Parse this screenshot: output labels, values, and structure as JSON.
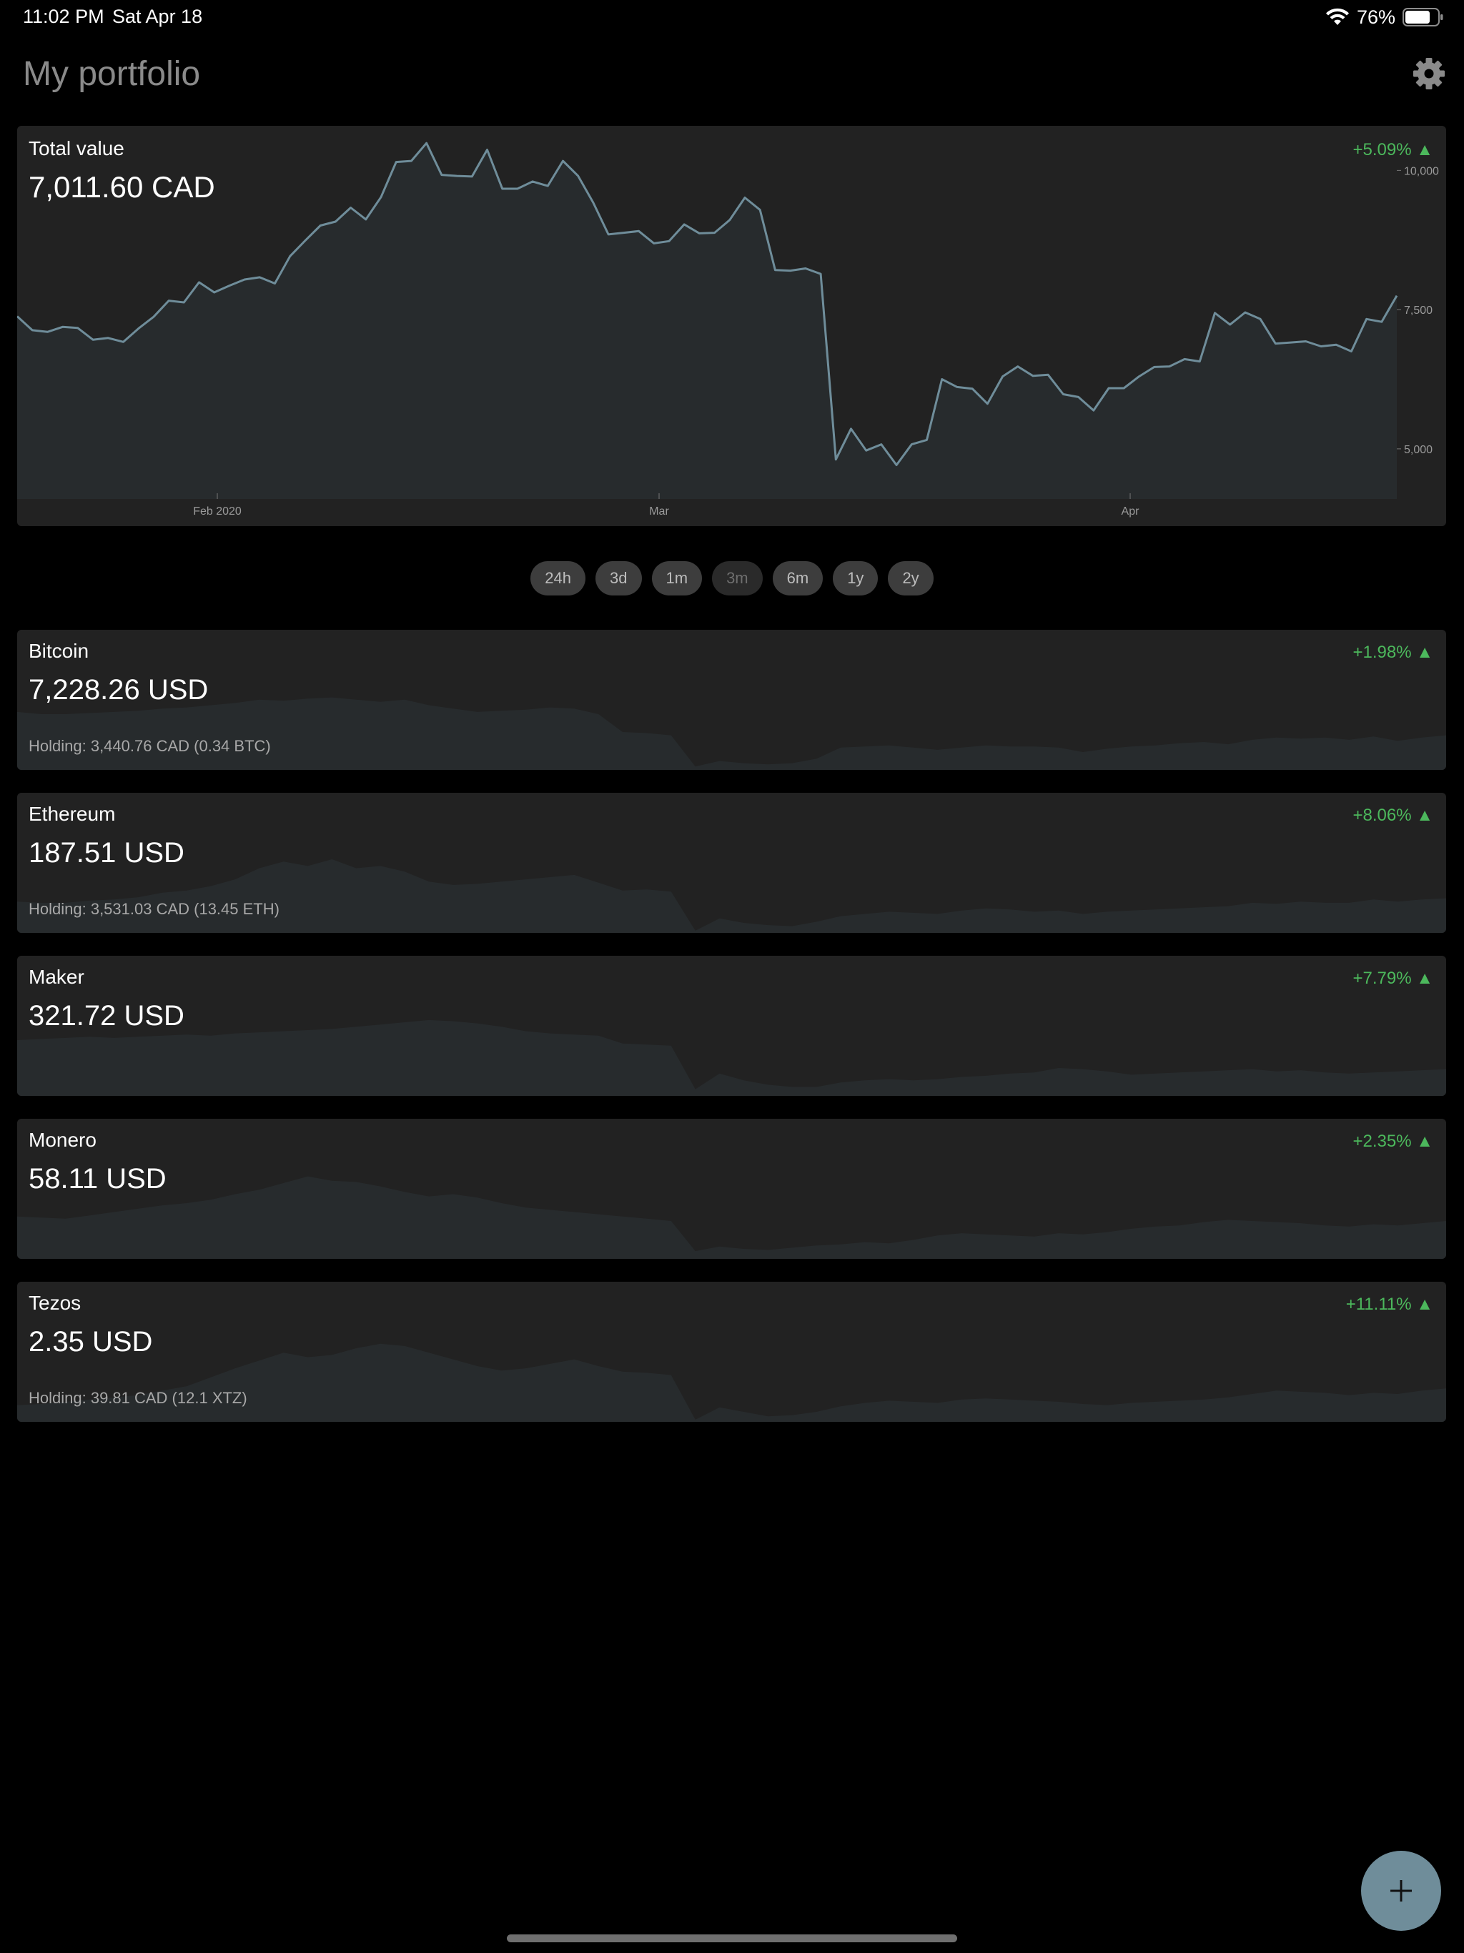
{
  "status_bar": {
    "time": "11:02 PM",
    "date": "Sat Apr 18",
    "battery": "76%"
  },
  "header": {
    "title": "My portfolio"
  },
  "total": {
    "label": "Total value",
    "value": "7,011.60 CAD",
    "change": "+5.09% ▲"
  },
  "chart_data": {
    "type": "area",
    "title": "",
    "xlabel": "",
    "ylabel": "",
    "y_ticks": [
      "10,000",
      "7,500",
      "5,000"
    ],
    "x_ticks": [
      "Feb 2020",
      "Mar",
      "Apr"
    ],
    "ylim": [
      4100,
      10800
    ],
    "grid": false,
    "series": [
      {
        "values": [
          7380,
          7130,
          7100,
          7190,
          7170,
          6960,
          6990,
          6920,
          7160,
          7370,
          7660,
          7630,
          7990,
          7810,
          7930,
          8040,
          8080,
          7970,
          8460,
          8740,
          9010,
          9080,
          9330,
          9120,
          9520,
          10150,
          10170,
          10490,
          9920,
          9900,
          9890,
          10370,
          9670,
          9670,
          9800,
          9720,
          10170,
          9900,
          9420,
          8850,
          8880,
          8910,
          8690,
          8730,
          9030,
          8870,
          8880,
          9110,
          9510,
          9290,
          8210,
          8200,
          8240,
          8140,
          4810,
          5360,
          4970,
          5080,
          4710,
          5080,
          5160,
          6250,
          6110,
          6080,
          5810,
          6300,
          6480,
          6310,
          6330,
          5980,
          5930,
          5690,
          6090,
          6090,
          6300,
          6470,
          6480,
          6610,
          6570,
          7440,
          7230,
          7450,
          7330,
          6890,
          6910,
          6930,
          6840,
          6870,
          6750,
          7330,
          7280,
          7750
        ]
      }
    ]
  },
  "ranges": [
    {
      "label": "24h"
    },
    {
      "label": "3d"
    },
    {
      "label": "1m"
    },
    {
      "label": "3m"
    },
    {
      "label": "6m"
    },
    {
      "label": "1y"
    },
    {
      "label": "2y"
    }
  ],
  "selected_range": "3m",
  "coins": [
    {
      "name": "Bitcoin",
      "price": "7,228.26 USD",
      "change": "+1.98% ▲",
      "holding": "Holding: 3,440.76 CAD (0.34 BTC)",
      "spark": [
        0.52,
        0.5,
        0.5,
        0.51,
        0.52,
        0.53,
        0.55,
        0.56,
        0.58,
        0.6,
        0.63,
        0.62,
        0.64,
        0.65,
        0.63,
        0.61,
        0.63,
        0.58,
        0.55,
        0.52,
        0.53,
        0.54,
        0.56,
        0.55,
        0.5,
        0.34,
        0.33,
        0.31,
        0.03,
        0.08,
        0.06,
        0.05,
        0.06,
        0.1,
        0.2,
        0.21,
        0.22,
        0.2,
        0.18,
        0.2,
        0.22,
        0.21,
        0.21,
        0.2,
        0.16,
        0.19,
        0.21,
        0.22,
        0.24,
        0.25,
        0.23,
        0.27,
        0.29,
        0.28,
        0.29,
        0.27,
        0.3,
        0.26,
        0.29,
        0.31
      ]
    },
    {
      "name": "Ethereum",
      "price": "187.51 USD",
      "change": "+8.06% ▲",
      "holding": "Holding: 3,531.03 CAD (13.45 ETH)",
      "spark": [
        0.28,
        0.27,
        0.27,
        0.29,
        0.3,
        0.32,
        0.36,
        0.38,
        0.42,
        0.48,
        0.58,
        0.64,
        0.6,
        0.66,
        0.58,
        0.6,
        0.55,
        0.46,
        0.43,
        0.44,
        0.46,
        0.48,
        0.5,
        0.52,
        0.45,
        0.38,
        0.39,
        0.37,
        0.02,
        0.13,
        0.09,
        0.07,
        0.06,
        0.1,
        0.15,
        0.17,
        0.19,
        0.18,
        0.17,
        0.2,
        0.22,
        0.21,
        0.19,
        0.2,
        0.17,
        0.19,
        0.2,
        0.21,
        0.22,
        0.23,
        0.24,
        0.27,
        0.26,
        0.28,
        0.27,
        0.27,
        0.3,
        0.28,
        0.3,
        0.31
      ]
    },
    {
      "name": "Maker",
      "price": "321.72 USD",
      "change": "+7.79% ▲",
      "holding": "",
      "spark": [
        0.5,
        0.51,
        0.52,
        0.53,
        0.52,
        0.53,
        0.54,
        0.55,
        0.54,
        0.56,
        0.57,
        0.58,
        0.59,
        0.6,
        0.62,
        0.64,
        0.66,
        0.68,
        0.67,
        0.65,
        0.62,
        0.58,
        0.56,
        0.55,
        0.54,
        0.47,
        0.46,
        0.45,
        0.06,
        0.2,
        0.14,
        0.1,
        0.08,
        0.08,
        0.12,
        0.14,
        0.15,
        0.14,
        0.15,
        0.17,
        0.18,
        0.2,
        0.21,
        0.25,
        0.24,
        0.22,
        0.19,
        0.2,
        0.21,
        0.22,
        0.23,
        0.24,
        0.22,
        0.23,
        0.21,
        0.2,
        0.21,
        0.22,
        0.23,
        0.24
      ]
    },
    {
      "name": "Monero",
      "price": "58.11 USD",
      "change": "+2.35% ▲",
      "holding": "",
      "spark": [
        0.38,
        0.37,
        0.36,
        0.39,
        0.42,
        0.45,
        0.48,
        0.5,
        0.53,
        0.58,
        0.62,
        0.68,
        0.74,
        0.7,
        0.69,
        0.65,
        0.6,
        0.56,
        0.58,
        0.55,
        0.5,
        0.46,
        0.44,
        0.42,
        0.4,
        0.38,
        0.36,
        0.34,
        0.07,
        0.11,
        0.09,
        0.08,
        0.1,
        0.12,
        0.13,
        0.15,
        0.14,
        0.17,
        0.21,
        0.23,
        0.22,
        0.21,
        0.2,
        0.23,
        0.22,
        0.24,
        0.27,
        0.29,
        0.3,
        0.33,
        0.35,
        0.34,
        0.33,
        0.32,
        0.3,
        0.29,
        0.31,
        0.3,
        0.32,
        0.34
      ]
    },
    {
      "name": "Tezos",
      "price": "2.35 USD",
      "change": "+11.11% ▲",
      "holding": "Holding: 39.81 CAD (12.1 XTZ)",
      "spark": [
        0.15,
        0.16,
        0.18,
        0.2,
        0.22,
        0.24,
        0.28,
        0.32,
        0.4,
        0.48,
        0.55,
        0.62,
        0.58,
        0.6,
        0.66,
        0.7,
        0.68,
        0.62,
        0.56,
        0.5,
        0.46,
        0.48,
        0.52,
        0.56,
        0.5,
        0.45,
        0.44,
        0.42,
        0.02,
        0.13,
        0.09,
        0.05,
        0.06,
        0.09,
        0.14,
        0.17,
        0.19,
        0.18,
        0.17,
        0.2,
        0.21,
        0.2,
        0.19,
        0.18,
        0.16,
        0.15,
        0.17,
        0.18,
        0.19,
        0.2,
        0.22,
        0.25,
        0.28,
        0.27,
        0.26,
        0.24,
        0.26,
        0.25,
        0.28,
        0.3
      ]
    }
  ],
  "fab": {
    "icon": "plus-icon"
  },
  "colors": {
    "background": "#000000",
    "card": "#222222",
    "chart_fill": "#272b2d",
    "chart_line": "#6f8d9a",
    "positive": "#4cb85c",
    "fab": "#6f8d9a"
  }
}
